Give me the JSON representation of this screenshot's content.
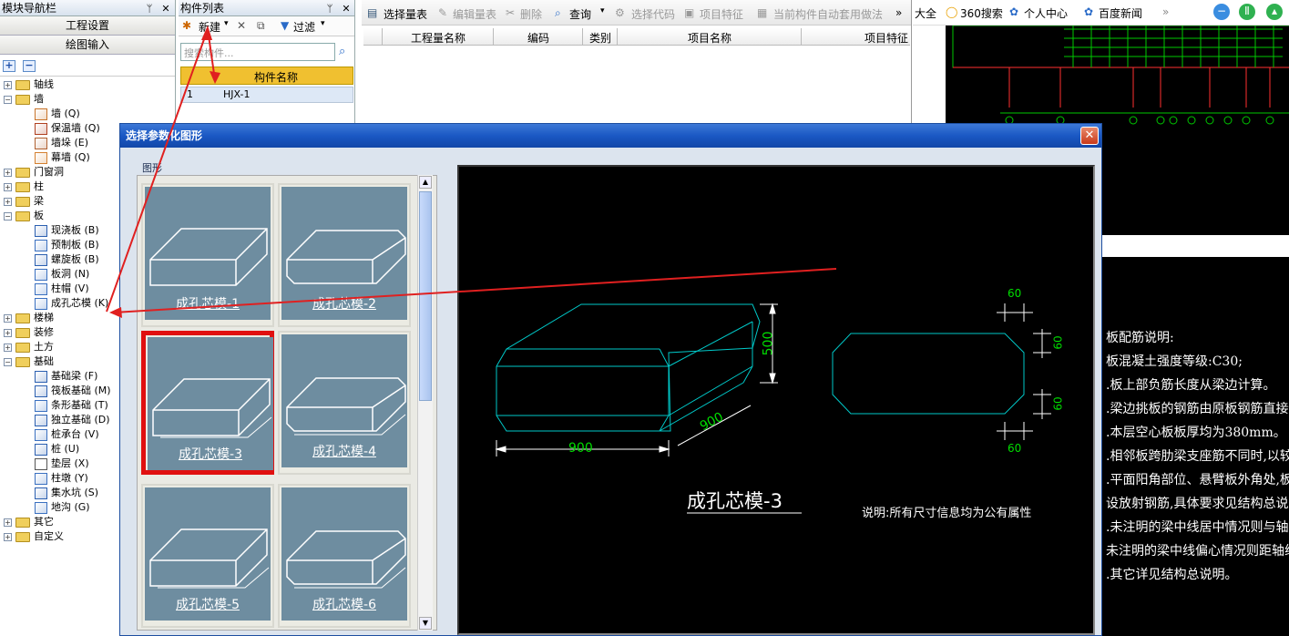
{
  "nav": {
    "title": "模块导航栏",
    "btn_project": "工程设置",
    "btn_draw": "绘图输入",
    "tree": [
      {
        "label": "轴线",
        "type": "folder",
        "state": "+"
      },
      {
        "label": "墙",
        "type": "folder",
        "state": "-"
      },
      {
        "label": "墙 (Q)",
        "type": "leaf"
      },
      {
        "label": "保温墙 (Q)",
        "type": "leaf"
      },
      {
        "label": "墙垛 (E)",
        "type": "leaf"
      },
      {
        "label": "幕墙 (Q)",
        "type": "leaf"
      },
      {
        "label": "门窗洞",
        "type": "folder",
        "state": "+"
      },
      {
        "label": "柱",
        "type": "folder",
        "state": "+"
      },
      {
        "label": "梁",
        "type": "folder",
        "state": "+"
      },
      {
        "label": "板",
        "type": "folder",
        "state": "-"
      },
      {
        "label": "现浇板 (B)",
        "type": "leaf"
      },
      {
        "label": "预制板 (B)",
        "type": "leaf"
      },
      {
        "label": "螺旋板 (B)",
        "type": "leaf"
      },
      {
        "label": "板洞 (N)",
        "type": "leaf"
      },
      {
        "label": "柱帽 (V)",
        "type": "leaf"
      },
      {
        "label": "成孔芯模 (K)",
        "type": "leaf"
      },
      {
        "label": "楼梯",
        "type": "folder",
        "state": "+"
      },
      {
        "label": "装修",
        "type": "folder",
        "state": "+"
      },
      {
        "label": "土方",
        "type": "folder",
        "state": "+"
      },
      {
        "label": "基础",
        "type": "folder",
        "state": "-"
      },
      {
        "label": "基础梁 (F)",
        "type": "leaf"
      },
      {
        "label": "筏板基础 (M)",
        "type": "leaf"
      },
      {
        "label": "条形基础 (T)",
        "type": "leaf"
      },
      {
        "label": "独立基础 (D)",
        "type": "leaf"
      },
      {
        "label": "桩承台 (V)",
        "type": "leaf"
      },
      {
        "label": "桩 (U)",
        "type": "leaf"
      },
      {
        "label": "垫层 (X)",
        "type": "leaf"
      },
      {
        "label": "柱墩 (Y)",
        "type": "leaf"
      },
      {
        "label": "集水坑 (S)",
        "type": "leaf"
      },
      {
        "label": "地沟 (G)",
        "type": "leaf"
      },
      {
        "label": "其它",
        "type": "folder",
        "state": "+"
      },
      {
        "label": "自定义",
        "type": "folder",
        "state": "+"
      }
    ]
  },
  "components": {
    "title": "构件列表",
    "new_label": "新建",
    "filter_label": "过滤",
    "search_placeholder": "搜索构件...",
    "col_name": "构件名称",
    "rows": [
      {
        "index": "1",
        "name": "HJX-1"
      }
    ]
  },
  "quantity": {
    "toolbar": [
      "选择量表",
      "编辑量表",
      "删除",
      "查询",
      "选择代码",
      "项目特征",
      "当前构件自动套用做法"
    ],
    "columns": [
      "工程量名称",
      "编码",
      "类别",
      "项目名称",
      "项目特征"
    ]
  },
  "browser": {
    "items": [
      "大全",
      "360搜索",
      "个人中心",
      "百度新闻"
    ]
  },
  "cad": {
    "notes": [
      "板配筋说明:",
      "板混凝土强度等级:C30;",
      ".板上部负筋长度从梁边计算。",
      ".梁边挑板的钢筋由原板钢筋直接伸出。",
      ".本层空心板板厚均为380mm。",
      ".相邻板跨肋梁支座筋不同时,以较大配筋通长",
      ".平面阳角部位、悬臂板外角处,板面应",
      " 设放射钢筋,具体要求见结构总说明。",
      ".未注明的梁中线居中情况则与轴线重合。",
      " 未注明的梁中线偏心情况则距轴线近边",
      ".其它详见结构总说明。"
    ]
  },
  "dialog": {
    "title": "选择参数化图形",
    "group_label": "图形",
    "shapes": [
      "成孔芯模-1",
      "成孔芯模-2",
      "成孔芯模-3",
      "成孔芯模-4",
      "成孔芯模-5",
      "成孔芯模-6"
    ],
    "selected_index": 2,
    "preview": {
      "title": "成孔芯模-3",
      "dim_length": "900",
      "dim_width": "900",
      "dim_height": "500",
      "dim_chamfer_top": "60",
      "dim_chamfer_right_top": "60",
      "dim_chamfer_right_bottom": "60",
      "dim_chamfer_bottom": "60",
      "note": "说明:所有尺寸信息均为公有属性"
    }
  },
  "colors": {
    "selection": "#e01010",
    "dimension": "#00dd00",
    "shape_line": "#00c8c8",
    "annotation_arrow": "#e02020"
  }
}
